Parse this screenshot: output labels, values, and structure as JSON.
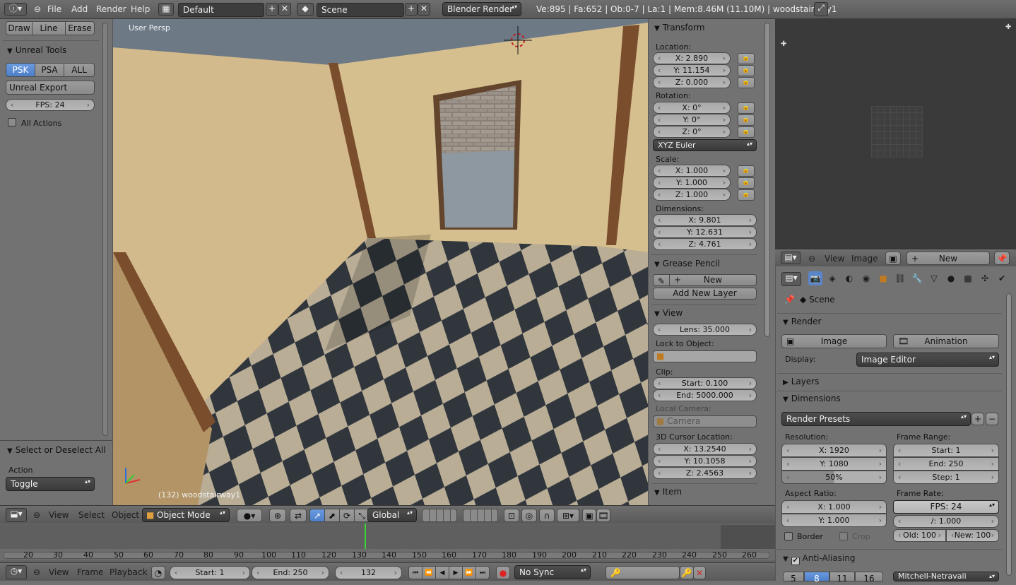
{
  "topbar": {
    "menus": [
      "File",
      "Add",
      "Render",
      "Help"
    ],
    "layout": "Default",
    "scene": "Scene",
    "engine": "Blender Render",
    "stats": "Ve:895 | Fa:652 | Ob:0-7 | La:1 | Mem:8.46M (11.10M) | woodstairway1"
  },
  "toolshelf": {
    "draw": "Draw",
    "line": "Line",
    "erase": "Erase",
    "unreal_title": "Unreal Tools",
    "psk": "PSK",
    "psa": "PSA",
    "all": "ALL",
    "export": "Unreal Export",
    "fps": "FPS: 24",
    "all_actions": "All Actions",
    "operator_title": "Select or Deselect All",
    "action_label": "Action",
    "action_value": "Toggle"
  },
  "viewport": {
    "label": "User Persp",
    "object_label": "(132) woodstairway1"
  },
  "npanel": {
    "transform": "Transform",
    "location_label": "Location:",
    "location": [
      "X: 2.890",
      "Y: 11.154",
      "Z: 0.000"
    ],
    "rotation_label": "Rotation:",
    "rotation": [
      "X: 0°",
      "Y: 0°",
      "Z: 0°"
    ],
    "rotation_mode": "XYZ Euler",
    "scale_label": "Scale:",
    "scale": [
      "X: 1.000",
      "Y: 1.000",
      "Z: 1.000"
    ],
    "dimensions_label": "Dimensions:",
    "dimensions": [
      "X: 9.801",
      "Y: 12.631",
      "Z: 4.761"
    ],
    "grease": "Grease Pencil",
    "new": "New",
    "add_layer": "Add New Layer",
    "view": "View",
    "lens": "Lens: 35.000",
    "lock_label": "Lock to Object:",
    "clip_label": "Clip:",
    "clip_start": "Start: 0.100",
    "clip_end": "End: 5000.000",
    "local_camera": "Local Camera:",
    "camera": "Camera",
    "cursor_label": "3D Cursor Location:",
    "cursor": [
      "X: 13.2540",
      "Y: 10.1058",
      "Z: 2.4563"
    ],
    "item": "Item"
  },
  "image_editor": {
    "view": "View",
    "image": "Image",
    "new": "New"
  },
  "properties": {
    "scene": "Scene",
    "render": "Render",
    "image_btn": "Image",
    "animation_btn": "Animation",
    "display_label": "Display:",
    "display_value": "Image Editor",
    "layers": "Layers",
    "dimensions": "Dimensions",
    "presets": "Render Presets",
    "resolution_label": "Resolution:",
    "res_x": "X: 1920",
    "res_y": "Y: 1080",
    "res_pct": "50%",
    "frame_range_label": "Frame Range:",
    "start": "Start: 1",
    "end": "End: 250",
    "step": "Step: 1",
    "aspect_label": "Aspect Ratio:",
    "asp_x": "X: 1.000",
    "asp_y": "Y: 1.000",
    "frame_rate_label": "Frame Rate:",
    "fps": "FPS: 24",
    "fps_base": "/: 1.000",
    "border": "Border",
    "crop": "Crop",
    "old": "Old: 100",
    "new": "New: 100",
    "antialias": "Anti-Aliasing",
    "aa_samples": [
      "5",
      "8",
      "11",
      "16"
    ],
    "aa_filter": "Mitchell-Netravali"
  },
  "vp_header": {
    "view": "View",
    "select": "Select",
    "object": "Object",
    "mode": "Object Mode",
    "orientation": "Global"
  },
  "timeline": {
    "ticks": [
      "20",
      "30",
      "40",
      "50",
      "60",
      "70",
      "80",
      "90",
      "100",
      "110",
      "120",
      "130",
      "140",
      "150",
      "160",
      "170",
      "180",
      "190",
      "200",
      "210",
      "220",
      "230",
      "240",
      "250",
      "260"
    ],
    "view": "View",
    "frame": "Frame",
    "playback": "Playback",
    "start": "Start: 1",
    "end": "End: 250",
    "current": "132",
    "sync": "No Sync"
  }
}
